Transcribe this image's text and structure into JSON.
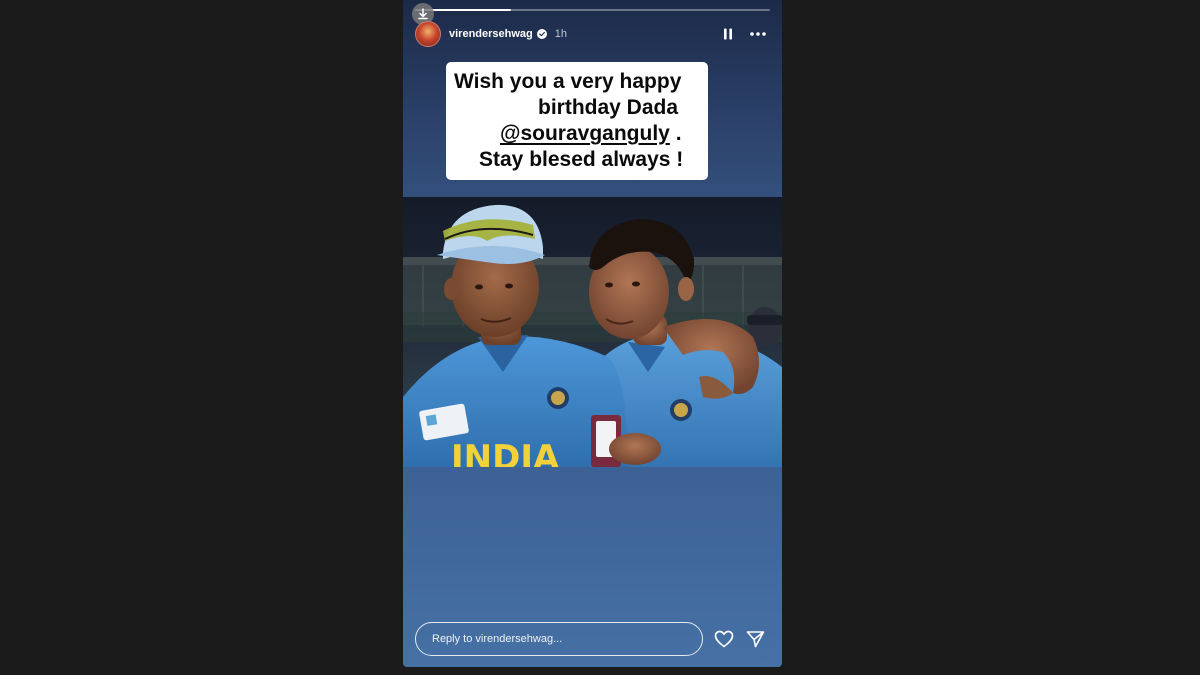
{
  "story": {
    "progress_fraction": 0.27,
    "username": "virendersehwag",
    "timestamp": "1h",
    "verified": true,
    "caption": {
      "line1": "Wish you a very happy",
      "line2": "birthday  Dada",
      "mention": "@souravganguly",
      "mention_suffix": " .",
      "line4": "Stay blesed always !"
    },
    "photo": {
      "jersey_text": "INDIA"
    },
    "reply": {
      "placeholder": "Reply to virendersehwag..."
    }
  },
  "icons": {
    "download": "download-icon",
    "verified": "verified-badge-icon",
    "pause": "pause-icon",
    "more": "more-icon",
    "heart": "heart-icon",
    "share": "send-icon"
  },
  "colors": {
    "page_background": "#1b1b1b",
    "story_top": "#1c2a48",
    "story_bottom": "#4671a5",
    "jersey_blue": "#3f86c9",
    "jersey_text": "#f2d13b",
    "verified_blue": "#ffffff"
  }
}
